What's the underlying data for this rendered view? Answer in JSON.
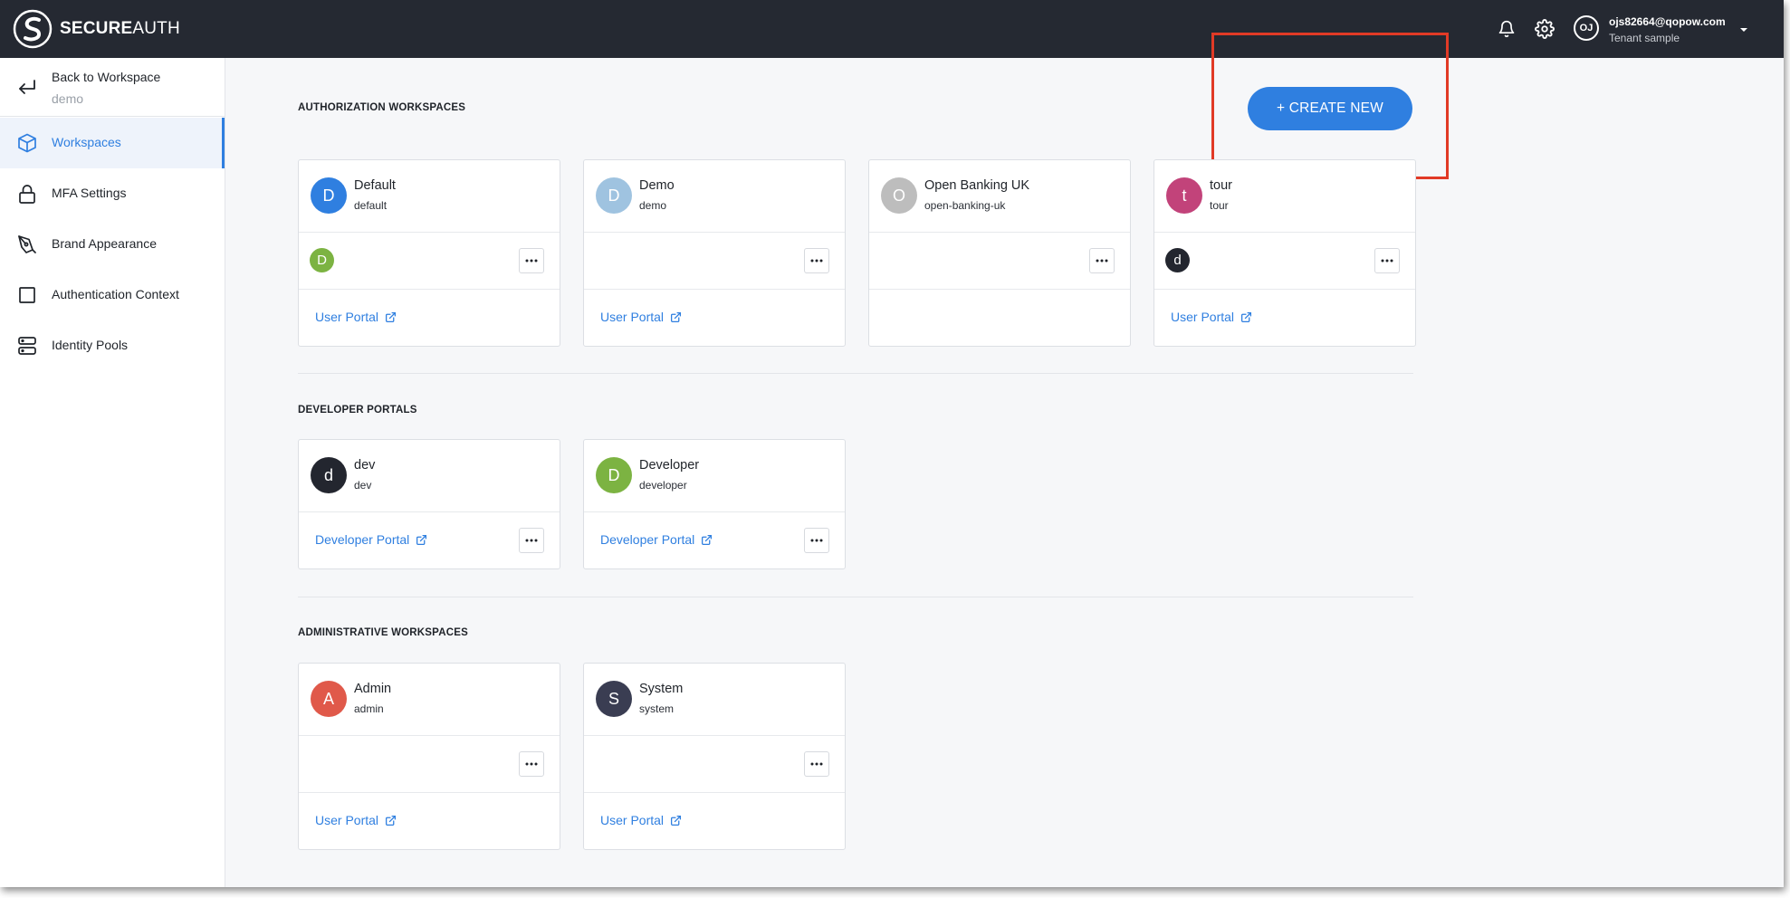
{
  "header": {
    "logo_text_bold": "SECURE",
    "logo_text_light": "AUTH",
    "user_initials": "OJ",
    "user_email": "ojs82664@qopow.com",
    "tenant": "Tenant sample",
    "icons": [
      "bell-icon",
      "gear-icon",
      "caret-down-icon"
    ]
  },
  "sidebar": {
    "back": {
      "title": "Back to Workspace",
      "subtitle": "demo"
    },
    "items": [
      {
        "label": "Workspaces",
        "icon": "cube-icon",
        "active": true
      },
      {
        "label": "MFA Settings",
        "icon": "lock-icon",
        "active": false
      },
      {
        "label": "Brand Appearance",
        "icon": "pen-icon",
        "active": false
      },
      {
        "label": "Authentication Context",
        "icon": "square-icon",
        "active": false
      },
      {
        "label": "Identity Pools",
        "icon": "server-icon",
        "active": false
      }
    ]
  },
  "main": {
    "create_label": "+ CREATE NEW",
    "sections": [
      {
        "title": "AUTHORIZATION WORKSPACES",
        "cards": [
          {
            "initial": "D",
            "name": "Default",
            "slug": "default",
            "color": "#2f7fe0",
            "mini": "D",
            "mini_color": "#7cb342",
            "link": "User Portal",
            "menu": true
          },
          {
            "initial": "D",
            "name": "Demo",
            "slug": "demo",
            "color": "#9fc3e0",
            "mini": "",
            "mini_color": "",
            "link": "User Portal",
            "menu": true
          },
          {
            "initial": "O",
            "name": "Open Banking UK",
            "slug": "open-banking-uk",
            "color": "#bdbdbd",
            "mini": "",
            "mini_color": "",
            "link": "",
            "menu": true
          },
          {
            "initial": "t",
            "name": "tour",
            "slug": "tour",
            "color": "#c2437a",
            "mini": "d",
            "mini_color": "#23262f",
            "link": "User Portal",
            "menu": true
          }
        ]
      },
      {
        "title": "DEVELOPER PORTALS",
        "cards": [
          {
            "initial": "d",
            "name": "dev",
            "slug": "dev",
            "color": "#23262f",
            "link": "Developer Portal"
          },
          {
            "initial": "D",
            "name": "Developer",
            "slug": "developer",
            "color": "#7cb342",
            "link": "Developer Portal"
          }
        ]
      },
      {
        "title": "ADMINISTRATIVE WORKSPACES",
        "cards": [
          {
            "initial": "A",
            "name": "Admin",
            "slug": "admin",
            "color": "#e0594a",
            "mini": "",
            "mini_color": "",
            "link": "User Portal",
            "menu": true
          },
          {
            "initial": "S",
            "name": "System",
            "slug": "system",
            "color": "#3a3d52",
            "mini": "",
            "mini_color": "",
            "link": "User Portal",
            "menu": true
          }
        ]
      }
    ]
  },
  "colors": {
    "accent": "#2f7fe0",
    "topbar": "#252932",
    "highlight": "#e13a26"
  }
}
